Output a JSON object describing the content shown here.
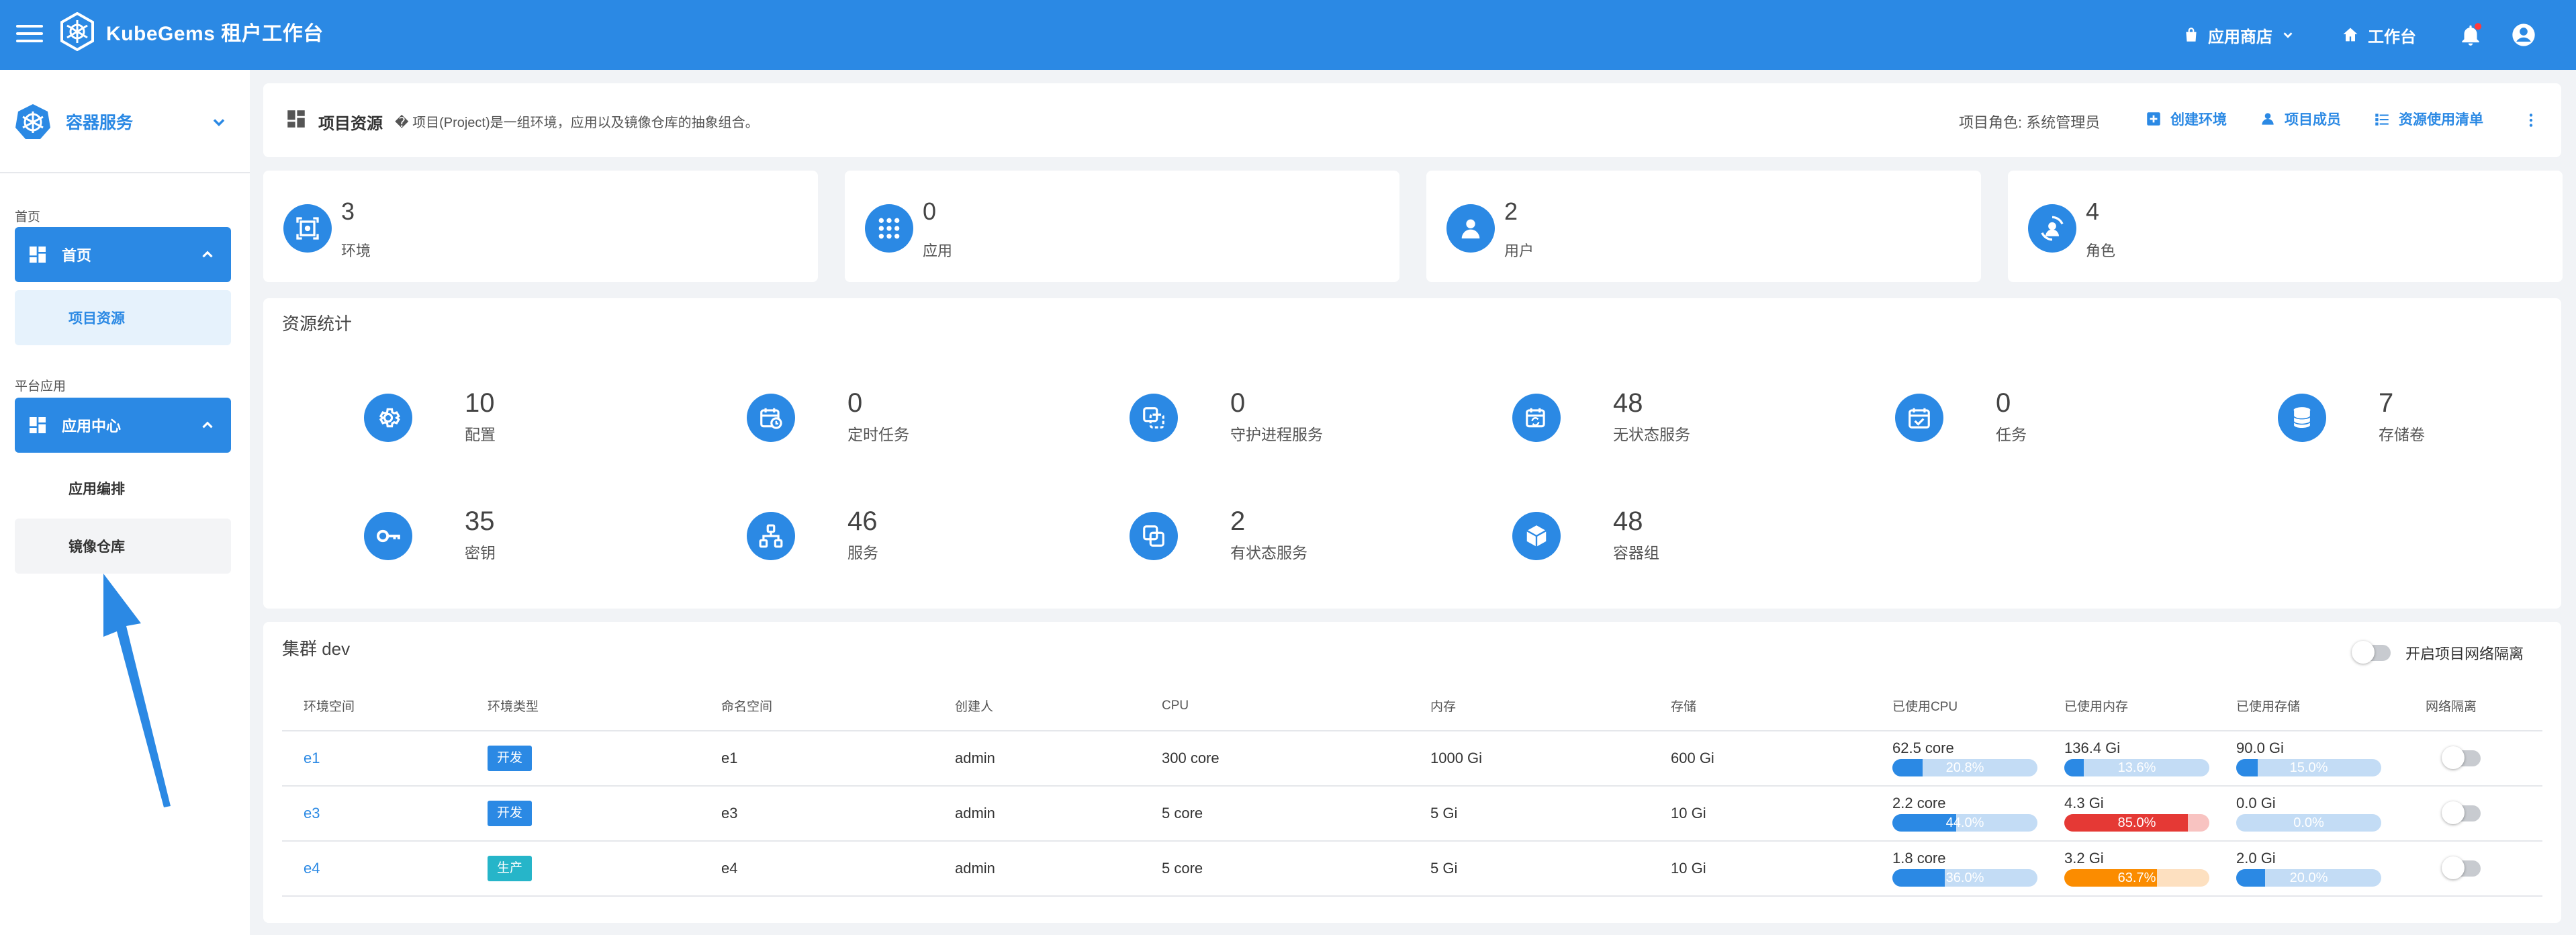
{
  "app": {
    "name": "KubeGems 租户工作台"
  },
  "topbar": {
    "app_store": "应用商店",
    "workbench": "工作台",
    "has_notification": true
  },
  "sidebar": {
    "title": "容器服务",
    "sections": [
      {
        "label": "首页",
        "group": "首页",
        "items": [
          "项目资源"
        ]
      },
      {
        "label": "平台应用",
        "group": "应用中心",
        "items": [
          "应用编排",
          "镜像仓库"
        ]
      }
    ]
  },
  "header": {
    "title": "项目资源",
    "description": "� 项目(Project)是一组环境，应用以及镜像仓库的抽象组合。",
    "role": "项目角色: 系统管理员",
    "actions": [
      "创建环境",
      "项目成员",
      "资源使用清单"
    ]
  },
  "stats": [
    {
      "value": "3",
      "label": "环境",
      "icon": "environment-icon"
    },
    {
      "value": "0",
      "label": "应用",
      "icon": "apps-grid-icon"
    },
    {
      "value": "2",
      "label": "用户",
      "icon": "user-icon"
    },
    {
      "value": "4",
      "label": "角色",
      "icon": "role-icon"
    }
  ],
  "resources": {
    "title": "资源统计",
    "items": [
      {
        "value": "10",
        "label": "配置",
        "icon": "gear-icon"
      },
      {
        "value": "0",
        "label": "定时任务",
        "icon": "calendar-clock-icon"
      },
      {
        "value": "0",
        "label": "守护进程服务",
        "icon": "daemon-icon"
      },
      {
        "value": "48",
        "label": "无状态服务",
        "icon": "calendar-sync-icon"
      },
      {
        "value": "0",
        "label": "任务",
        "icon": "calendar-check-icon"
      },
      {
        "value": "7",
        "label": "存储卷",
        "icon": "database-icon"
      },
      {
        "value": "35",
        "label": "密钥",
        "icon": "key-icon"
      },
      {
        "value": "46",
        "label": "服务",
        "icon": "network-icon"
      },
      {
        "value": "2",
        "label": "有状态服务",
        "icon": "stack-icon"
      },
      {
        "value": "48",
        "label": "容器组",
        "icon": "cube-icon"
      }
    ]
  },
  "cluster": {
    "title": "集群 dev",
    "isolation_label": "开启项目网络隔离",
    "columns": [
      "环境空间",
      "环境类型",
      "命名空间",
      "创建人",
      "CPU",
      "内存",
      "存储",
      "已使用CPU",
      "已使用内存",
      "已使用存储",
      "网络隔离"
    ],
    "rows": [
      {
        "env": "e1",
        "type": "开发",
        "type_color": "#2b89e4",
        "ns": "e1",
        "creator": "admin",
        "cpu": "300 core",
        "mem": "1000 Gi",
        "storage": "600 Gi",
        "used_cpu": {
          "value": "62.5 core",
          "pct_text": "20.8%",
          "pct": 20.8,
          "color": "#2b89e4",
          "bg": "#c3dcf5"
        },
        "used_mem": {
          "value": "136.4 Gi",
          "pct_text": "13.6%",
          "pct": 13.6,
          "color": "#2b89e4",
          "bg": "#c3dcf5"
        },
        "used_storage": {
          "value": "90.0 Gi",
          "pct_text": "15.0%",
          "pct": 15.0,
          "color": "#2b89e4",
          "bg": "#c3dcf5"
        }
      },
      {
        "env": "e3",
        "type": "开发",
        "type_color": "#2b89e4",
        "ns": "e3",
        "creator": "admin",
        "cpu": "5 core",
        "mem": "5 Gi",
        "storage": "10 Gi",
        "used_cpu": {
          "value": "2.2 core",
          "pct_text": "44.0%",
          "pct": 44.0,
          "color": "#2b89e4",
          "bg": "#c3dcf5"
        },
        "used_mem": {
          "value": "4.3 Gi",
          "pct_text": "85.0%",
          "pct": 85.0,
          "color": "#e53935",
          "bg": "#f8c3c1"
        },
        "used_storage": {
          "value": "0.0 Gi",
          "pct_text": "0.0%",
          "pct": 0.0,
          "color": "#2b89e4",
          "bg": "#c3dcf5"
        }
      },
      {
        "env": "e4",
        "type": "生产",
        "type_color": "#26b5c9",
        "ns": "e4",
        "creator": "admin",
        "cpu": "5 core",
        "mem": "5 Gi",
        "storage": "10 Gi",
        "used_cpu": {
          "value": "1.8 core",
          "pct_text": "36.0%",
          "pct": 36.0,
          "color": "#2b89e4",
          "bg": "#c3dcf5"
        },
        "used_mem": {
          "value": "3.2 Gi",
          "pct_text": "63.7%",
          "pct": 63.7,
          "color": "#fb8c00",
          "bg": "#fde0c0"
        },
        "used_storage": {
          "value": "2.0 Gi",
          "pct_text": "20.0%",
          "pct": 20.0,
          "color": "#2b89e4",
          "bg": "#c3dcf5"
        }
      }
    ]
  }
}
